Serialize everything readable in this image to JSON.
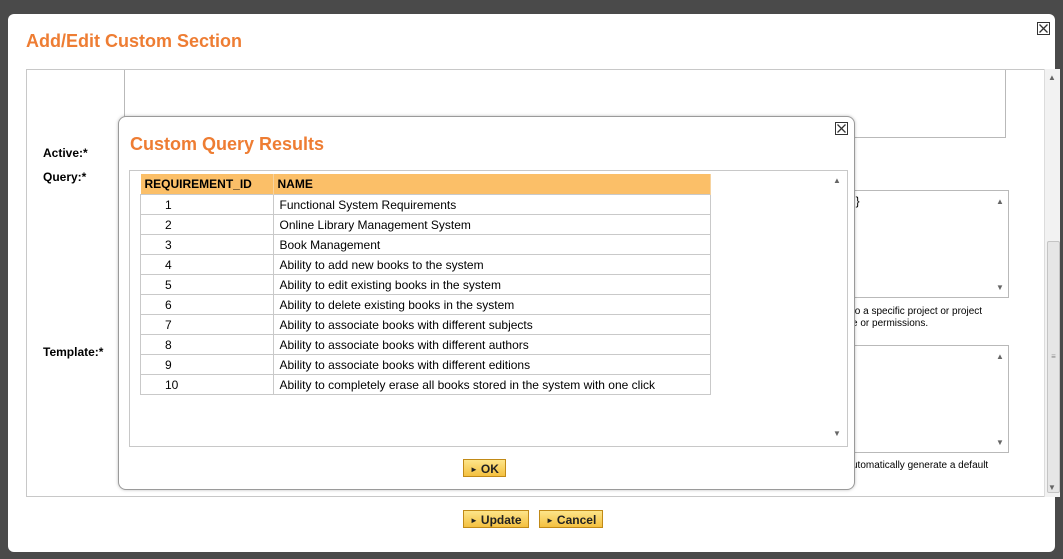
{
  "outer_dialog": {
    "title": "Add/Edit Custom Section",
    "close_icon": "close-icon",
    "labels": {
      "active": "Active:*",
      "query": "Query:*",
      "template": "Template:*"
    },
    "query_text_fragment": "d}",
    "query_hint_line1": "to a specific project or project",
    "query_hint_line2": "e or permissions.",
    "template_hint": "utomatically generate a default",
    "buttons": {
      "update": "Update",
      "cancel": "Cancel"
    }
  },
  "inner_dialog": {
    "title": "Custom Query Results",
    "close_icon": "close-icon",
    "ok_label": "OK",
    "columns": [
      "REQUIREMENT_ID",
      "NAME"
    ],
    "rows": [
      {
        "id": "1",
        "name": "Functional System Requirements"
      },
      {
        "id": "2",
        "name": "Online Library Management System"
      },
      {
        "id": "3",
        "name": "Book Management"
      },
      {
        "id": "4",
        "name": "Ability to add new books to the system"
      },
      {
        "id": "5",
        "name": "Ability to edit existing books in the system"
      },
      {
        "id": "6",
        "name": "Ability to delete existing books in the system"
      },
      {
        "id": "7",
        "name": "Ability to associate books with different subjects"
      },
      {
        "id": "8",
        "name": "Ability to associate books with different authors"
      },
      {
        "id": "9",
        "name": "Ability to associate books with different editions"
      },
      {
        "id": "10",
        "name": "Ability to completely erase all books stored in the system with one click"
      }
    ]
  },
  "colors": {
    "title_orange": "#ee7d33",
    "header_orange": "#fbbf68",
    "button_gold": "#f4c040"
  }
}
